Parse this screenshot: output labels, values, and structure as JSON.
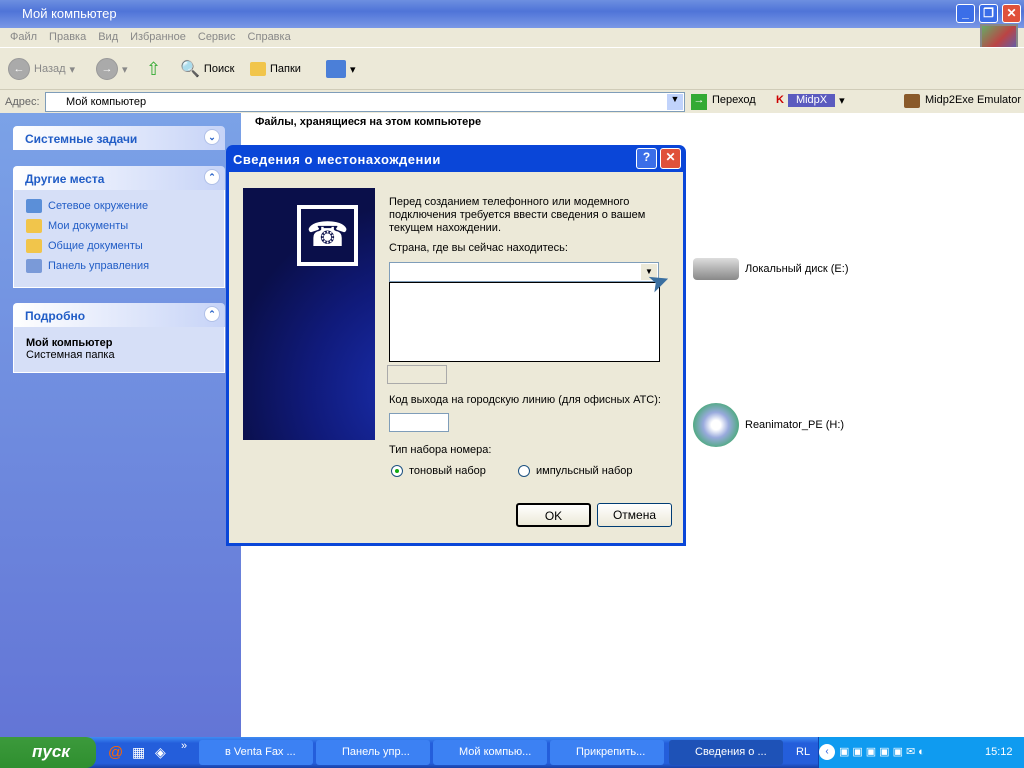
{
  "window": {
    "title": "Мой компьютер"
  },
  "menu": [
    "Файл",
    "Правка",
    "Вид",
    "Избранное",
    "Сервис",
    "Справка"
  ],
  "toolbar": {
    "back": "Назад",
    "search": "Поиск",
    "folders": "Папки"
  },
  "address": {
    "label": "Адрес:",
    "value": "Мой компьютер",
    "go": "Переход",
    "midpx": "MidpX",
    "midp2exe": "Midp2Exe Emulator"
  },
  "leftpane": {
    "system_tasks": "Системные задачи",
    "other_places": {
      "title": "Другие места",
      "items": [
        "Сетевое окружение",
        "Мои документы",
        "Общие документы",
        "Панель управления"
      ]
    },
    "details": {
      "title": "Подробно",
      "name": "Мой компьютер",
      "type": "Системная папка"
    }
  },
  "content": {
    "header": "Файлы, хранящиеся на этом компьютере",
    "drives": [
      "Локальный диск (E:)",
      "Reanimator_PE (H:)"
    ]
  },
  "dialog": {
    "title": "Сведения о местонахождении",
    "intro": "Перед созданием телефонного или модемного подключения требуется ввести сведения о вашем текущем нахождении.",
    "country_label": "Страна, где вы сейчас находитесь:",
    "country_value": "",
    "outside_line_label": "Код выхода на городскую линию (для офисных АТС):",
    "outside_line_value": "",
    "dial_type_label": "Тип набора номера:",
    "tone": "тоновый набор",
    "pulse": "импульсный набор",
    "selected": "tone",
    "ok": "OK",
    "cancel": "Отмена"
  },
  "taskbar": {
    "start": "пуск",
    "tasks": [
      "в Venta Fax ...",
      "Панель упр...",
      "Мой компью...",
      "Прикрепить...",
      "Сведения о ..."
    ],
    "lang": "RL",
    "clock": "15:12"
  }
}
